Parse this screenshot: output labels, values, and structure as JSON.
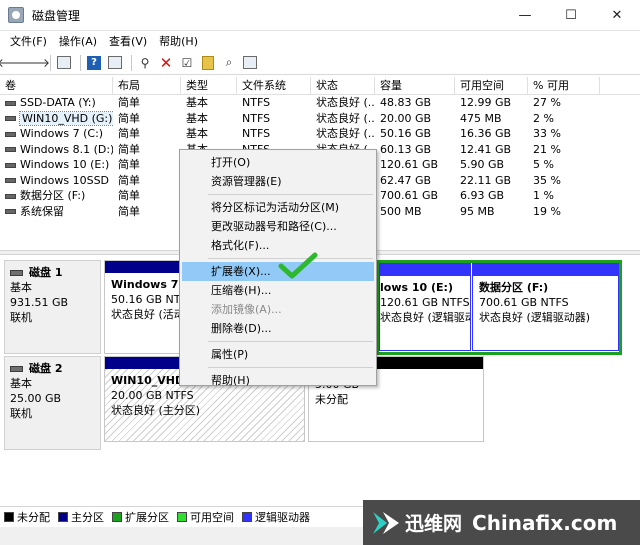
{
  "window": {
    "title": "磁盘管理",
    "minimize": "—",
    "maximize": "☐",
    "close": "✕"
  },
  "menu": [
    "文件(F)",
    "操作(A)",
    "查看(V)",
    "帮助(H)"
  ],
  "table": {
    "columns": [
      "卷",
      "布局",
      "类型",
      "文件系统",
      "状态",
      "容量",
      "可用空间",
      "% 可用"
    ],
    "rows": [
      [
        "SSD-DATA (Y:)",
        "简单",
        "基本",
        "NTFS",
        "状态良好 (...",
        "48.83 GB",
        "12.99 GB",
        "27 %"
      ],
      [
        "WIN10_VHD (G:)",
        "简单",
        "基本",
        "NTFS",
        "状态良好 (...",
        "20.00 GB",
        "475 MB",
        "2 %"
      ],
      [
        "Windows 7 (C:)",
        "简单",
        "基本",
        "NTFS",
        "状态良好 (...",
        "50.16 GB",
        "16.36 GB",
        "33 %"
      ],
      [
        "Windows 8.1 (D:)",
        "简单",
        "基本",
        "NTFS",
        "状态良好 (...",
        "60.13 GB",
        "12.41 GB",
        "21 %"
      ],
      [
        "Windows 10 (E:)",
        "简单",
        "",
        "",
        "",
        "120.61 GB",
        "5.90 GB",
        "5 %"
      ],
      [
        "Windows 10SSD ...",
        "简单",
        "",
        "",
        "",
        "62.47 GB",
        "22.11 GB",
        "35 %"
      ],
      [
        "数据分区 (F:)",
        "简单",
        "",
        "",
        "",
        "700.61 GB",
        "6.93 GB",
        "1 %"
      ],
      [
        "系统保留",
        "简单",
        "",
        "",
        "",
        "500 MB",
        "95 MB",
        "19 %"
      ]
    ]
  },
  "disks": [
    {
      "name": "磁盘 1",
      "type": "基本",
      "size": "931.51 GB",
      "status": "联机",
      "partitions": [
        {
          "name": "Windows 7（",
          "line2": "50.16 GB NTFS",
          "line3": "状态良好 (活动"
        },
        {
          "name": "lows 10 (E:)",
          "line2": "120.61 GB NTFS",
          "line3": "状态良好 (逻辑驱动器)"
        },
        {
          "name": "数据分区 (F:)",
          "line2": "700.61 GB NTFS",
          "line3": "状态良好 (逻辑驱动器)"
        }
      ]
    },
    {
      "name": "磁盘 2",
      "type": "基本",
      "size": "25.00 GB",
      "status": "联机",
      "partitions": [
        {
          "name": "WIN10_VHD",
          "line2": "20.00 GB NTFS",
          "line3": "状态良好 (主分区)"
        },
        {
          "name": "",
          "line2": "5.00 GB",
          "line3": "未分配"
        }
      ]
    }
  ],
  "legend": [
    {
      "label": "未分配",
      "color": "#000000"
    },
    {
      "label": "主分区",
      "color": "#00008b"
    },
    {
      "label": "扩展分区",
      "color": "#1ca11c"
    },
    {
      "label": "可用空间",
      "color": "#33dd33"
    },
    {
      "label": "逻辑驱动器",
      "color": "#3333ff"
    }
  ],
  "context_menu": {
    "open": "打开(O)",
    "explorer": "资源管理器(E)",
    "mark_active": "将分区标记为活动分区(M)",
    "change_letter": "更改驱动器号和路径(C)...",
    "format": "格式化(F)...",
    "extend": "扩展卷(X)...",
    "shrink": "压缩卷(H)...",
    "add_mirror": "添加镜像(A)...",
    "delete": "删除卷(D)...",
    "properties": "属性(P)",
    "help": "帮助(H)"
  },
  "watermark": {
    "cn": "迅维网",
    "en": "Chinafix.com"
  },
  "colors": {
    "primary": "#00008b",
    "extended": "#1ca11c",
    "highlight": "#91c9f7"
  }
}
